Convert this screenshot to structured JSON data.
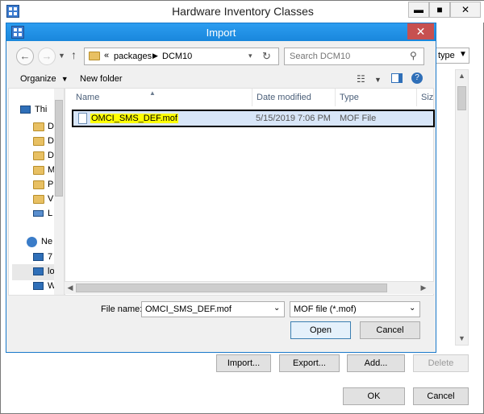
{
  "bg_window": {
    "title": "Hardware Inventory Classes",
    "type_dropdown": "type",
    "buttons": {
      "import": "Import...",
      "export": "Export...",
      "add": "Add...",
      "delete": "Delete",
      "ok": "OK",
      "cancel": "Cancel"
    }
  },
  "dialog": {
    "title": "Import",
    "breadcrumb": {
      "overflow": "«",
      "items": [
        "packages",
        "DCM10"
      ]
    },
    "search_placeholder": "Search DCM10",
    "toolbar": {
      "organize": "Organize",
      "new_folder": "New folder"
    },
    "nav_pane": {
      "items": [
        {
          "label": "Thi",
          "icon": "computer-icon"
        },
        {
          "label": "D",
          "icon": "folder-icon"
        },
        {
          "label": "D",
          "icon": "folder-icon"
        },
        {
          "label": "D",
          "icon": "folder-icon"
        },
        {
          "label": "M",
          "icon": "folder-icon"
        },
        {
          "label": "P",
          "icon": "folder-icon"
        },
        {
          "label": "V",
          "icon": "folder-icon"
        },
        {
          "label": "L",
          "icon": "drive-icon"
        },
        {
          "label": "Ne",
          "icon": "network-icon"
        },
        {
          "label": "7",
          "icon": "computer-icon"
        },
        {
          "label": "lo",
          "icon": "computer-icon"
        },
        {
          "label": "W",
          "icon": "computer-icon"
        }
      ]
    },
    "columns": [
      "Name",
      "Date modified",
      "Type",
      "Siz"
    ],
    "files": [
      {
        "name": "OMCI_SMS_DEF.mof",
        "date": "5/15/2019 7:06 PM",
        "type": "MOF File",
        "size": ""
      }
    ],
    "file_name_label": "File name:",
    "file_name_value": "OMCI_SMS_DEF.mof",
    "filter_value": "MOF file (*.mof)",
    "open": "Open",
    "cancel": "Cancel"
  },
  "colors": {
    "dialog_title_bar": "#1987dc",
    "close_button": "#c75050",
    "selection": "#d8e6f8",
    "highlight": "#ffff00"
  }
}
